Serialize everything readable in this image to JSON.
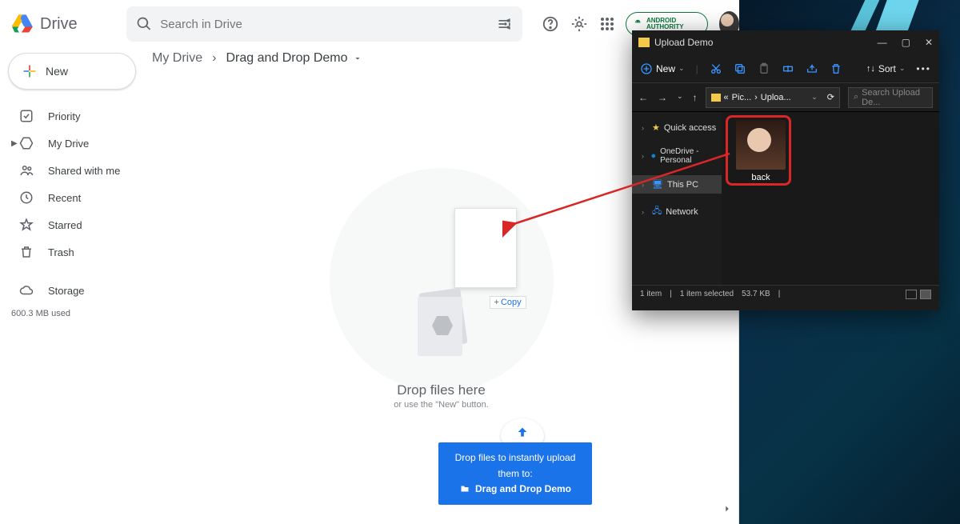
{
  "drive": {
    "app_title": "Drive",
    "search_placeholder": "Search in Drive",
    "badge_text": "ANDROID AUTHORITY",
    "new_button": "New",
    "sidebar": [
      {
        "label": "Priority",
        "icon": "check-circle"
      },
      {
        "label": "My Drive",
        "icon": "drive"
      },
      {
        "label": "Shared with me",
        "icon": "people"
      },
      {
        "label": "Recent",
        "icon": "clock"
      },
      {
        "label": "Starred",
        "icon": "star"
      },
      {
        "label": "Trash",
        "icon": "trash"
      }
    ],
    "storage_label": "Storage",
    "storage_used": "600.3 MB used",
    "breadcrumb": {
      "root": "My Drive",
      "current": "Drag and Drop Demo"
    },
    "dropzone": {
      "title": "Drop files here",
      "subtitle": "or use the \"New\" button.",
      "copy_badge": "Copy"
    },
    "upload_bar": {
      "line1": "Drop files to instantly upload them to:",
      "line2": "Drag and Drop Demo"
    }
  },
  "explorer": {
    "title": "Upload Demo",
    "new_label": "New",
    "sort_label": "Sort",
    "path": {
      "seg1": "Pic...",
      "seg2": "Uploa..."
    },
    "search_placeholder": "Search Upload De...",
    "tree": [
      {
        "label": "Quick access",
        "color": "#f7c948"
      },
      {
        "label": "OneDrive - Personal",
        "color": "#0a84d6"
      },
      {
        "label": "This PC",
        "color": "#3794ff",
        "selected": true
      },
      {
        "label": "Network",
        "color": "#3794ff"
      }
    ],
    "file": {
      "name": "back"
    },
    "status": {
      "count": "1 item",
      "selected": "1 item selected",
      "size": "53.7 KB"
    }
  }
}
